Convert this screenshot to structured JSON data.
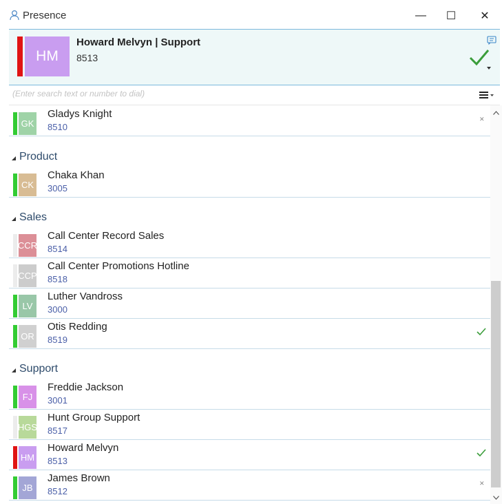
{
  "window": {
    "title": "Presence",
    "minimize_glyph": "—",
    "maximize_glyph": "☐",
    "close_glyph": "✕"
  },
  "header": {
    "initials": "HM",
    "name": "Howard Melvyn | Support",
    "extension": "8513",
    "status_color": "#e01414",
    "avatar_color": "#c99df0",
    "icons": [
      "contact-card-icon",
      "checkmark-icon",
      "caret-down-icon"
    ]
  },
  "search": {
    "placeholder": "(Enter search text or number to dial)"
  },
  "menu_icon": "hamburger-menu-icon",
  "contacts_top": [
    {
      "initials": "GK",
      "name": "Gladys Knight",
      "extension": "8510",
      "avatar_color": "#9fd3a7",
      "status_color": "#33cc33",
      "indicator": "x"
    }
  ],
  "groups": [
    {
      "label": "Product",
      "contacts": [
        {
          "initials": "CK",
          "name": "Chaka Khan",
          "extension": "3005",
          "avatar_color": "#d8bc94",
          "status_color": "#33cc33",
          "indicator": ""
        }
      ]
    },
    {
      "label": "Sales",
      "contacts": [
        {
          "initials": "CCR",
          "name": "Call Center Record Sales",
          "extension": "8514",
          "avatar_color": "#dc8f97",
          "status_color": "#ececec",
          "indicator": ""
        },
        {
          "initials": "CCP",
          "name": "Call Center Promotions Hotline",
          "extension": "8518",
          "avatar_color": "#cccccc",
          "status_color": "#ececec",
          "indicator": ""
        },
        {
          "initials": "LV",
          "name": "Luther Vandross",
          "extension": "3000",
          "avatar_color": "#99c7a8",
          "status_color": "#33cc33",
          "indicator": ""
        },
        {
          "initials": "OR",
          "name": "Otis Redding",
          "extension": "8519",
          "avatar_color": "#d0d0d0",
          "status_color": "#33cc33",
          "indicator": "check"
        }
      ]
    },
    {
      "label": "Support",
      "contacts": [
        {
          "initials": "FJ",
          "name": "Freddie Jackson",
          "extension": "3001",
          "avatar_color": "#d891e8",
          "status_color": "#33cc33",
          "indicator": ""
        },
        {
          "initials": "HGS",
          "name": "Hunt Group Support",
          "extension": "8517",
          "avatar_color": "#b8d99a",
          "status_color": "#ececec",
          "indicator": ""
        },
        {
          "initials": "HM",
          "name": "Howard Melvyn",
          "extension": "8513",
          "avatar_color": "#c99df0",
          "status_color": "#e01414",
          "indicator": "check"
        },
        {
          "initials": "JB",
          "name": "James Brown",
          "extension": "8512",
          "avatar_color": "#a3a6d6",
          "status_color": "#33cc33",
          "indicator": "x"
        }
      ]
    }
  ],
  "colors": {
    "accent": "#7bb8dc",
    "online": "#33cc33",
    "busy": "#e01414",
    "check": "#3a9d3a",
    "group_label": "#2e4b6b",
    "extension_text": "#4a5fa8"
  }
}
